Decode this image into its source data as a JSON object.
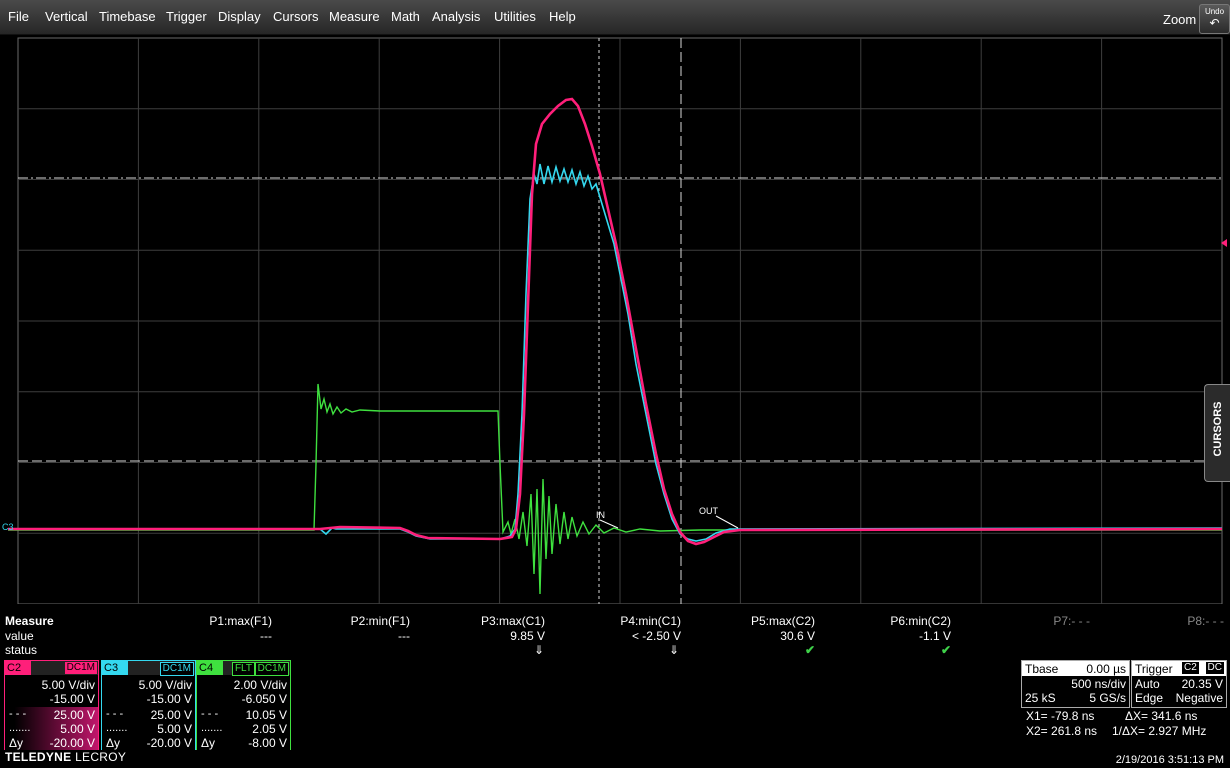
{
  "menu": {
    "items": [
      "File",
      "Vertical",
      "Timebase",
      "Trigger",
      "Display",
      "Cursors",
      "Measure",
      "Math",
      "Analysis",
      "Utilities",
      "Help"
    ],
    "zoom_label": "Zoom",
    "undo_label": "Undo"
  },
  "grid": {
    "trace_labels": {
      "c3_marker": "C3",
      "trigger_in": "IN",
      "trigger_out": "OUT"
    }
  },
  "traces": {
    "colors": {
      "c2": "#ff1f7a",
      "c3": "#34d8ef",
      "c4": "#3fe03f"
    }
  },
  "cursors_tab": {
    "label": "CURSORS"
  },
  "measure": {
    "title": "Measure",
    "row_value": "value",
    "row_status": "status",
    "params": [
      {
        "name": "P1:max(F1)",
        "value": "---",
        "status": ""
      },
      {
        "name": "P2:min(F1)",
        "value": "---",
        "status": ""
      },
      {
        "name": "P3:max(C1)",
        "value": "9.85 V",
        "status": "⇓"
      },
      {
        "name": "P4:min(C1)",
        "value": "< -2.50 V",
        "status": "⇓"
      },
      {
        "name": "P5:max(C2)",
        "value": "30.6 V",
        "status": "✔"
      },
      {
        "name": "P6:min(C2)",
        "value": "-1.1 V",
        "status": "✔"
      }
    ],
    "p7": "P7:- - -",
    "p8": "P8:- - -"
  },
  "channels": [
    {
      "name": "C2",
      "coupling": "DC1M",
      "color": "#ff1f7a",
      "vdiv": "5.00 V/div",
      "offset": "-15.00 V",
      "c1": "25.00 V",
      "c2": "5.00 V",
      "dy_label": "Δy",
      "dy": "-20.00 V"
    },
    {
      "name": "C3",
      "coupling": "DC1M",
      "color": "#34d8ef",
      "vdiv": "5.00 V/div",
      "offset": "-15.00 V",
      "c1": "25.00 V",
      "c2": "5.00 V",
      "dy_label": "Δy",
      "dy": "-20.00 V"
    },
    {
      "name": "C4",
      "coupling": "DC1M",
      "flt": "FLT",
      "color": "#3fe03f",
      "vdiv": "2.00 V/div",
      "offset": "-6.050 V",
      "c1": "10.05 V",
      "c2": "2.05 V",
      "dy_label": "Δy",
      "dy": "-8.00 V"
    }
  ],
  "timebase": {
    "label": "Tbase",
    "delay": "0.00 µs",
    "tdiv": "500 ns/div",
    "samples": "25 kS",
    "rate": "5 GS/s"
  },
  "trigger": {
    "label": "Trigger",
    "source": "C2",
    "coupling": "DC",
    "mode": "Auto",
    "level": "20.35 V",
    "type": "Edge",
    "slope": "Negative"
  },
  "cursor_readout": {
    "x1": "X1= -79.8 ns",
    "dx": "ΔX= 341.6 ns",
    "x2": "X2= 261.8 ns",
    "inv": "1/ΔX= 2.927 MHz"
  },
  "footer": {
    "brand_bold": "TELEDYNE",
    "brand_light": "LECROY",
    "datetime": "2/19/2016 3:51:13 PM"
  }
}
